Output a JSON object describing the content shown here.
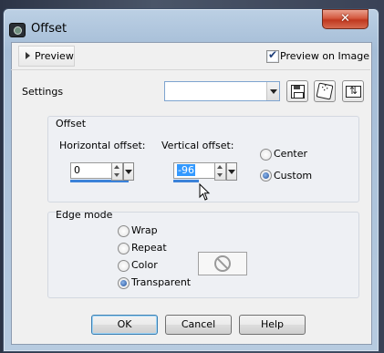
{
  "window": {
    "title": "Offset",
    "close_glyph": "✕"
  },
  "header": {
    "preview_label": "Preview",
    "preview_on_image_label": "Preview on Image",
    "preview_on_image_checked": true
  },
  "settings": {
    "label": "Settings",
    "preset_value": "",
    "icons": [
      "save-preset-icon",
      "randomize-dice-icon",
      "reset-defaults-icon"
    ]
  },
  "offset_group": {
    "title": "Offset",
    "horizontal_label": "Horizontal offset:",
    "horizontal_value": "0",
    "vertical_label": "Vertical offset:",
    "vertical_value": "-96",
    "radio_center": "Center",
    "radio_custom": "Custom",
    "selected": "Custom"
  },
  "edge_group": {
    "title": "Edge mode",
    "options": [
      "Wrap",
      "Repeat",
      "Color",
      "Transparent"
    ],
    "selected": "Transparent"
  },
  "buttons": {
    "ok": "OK",
    "cancel": "Cancel",
    "help": "Help"
  },
  "colors": {
    "accent": "#3b82d9",
    "close_red": "#c0381f",
    "selection": "#3399ff"
  }
}
